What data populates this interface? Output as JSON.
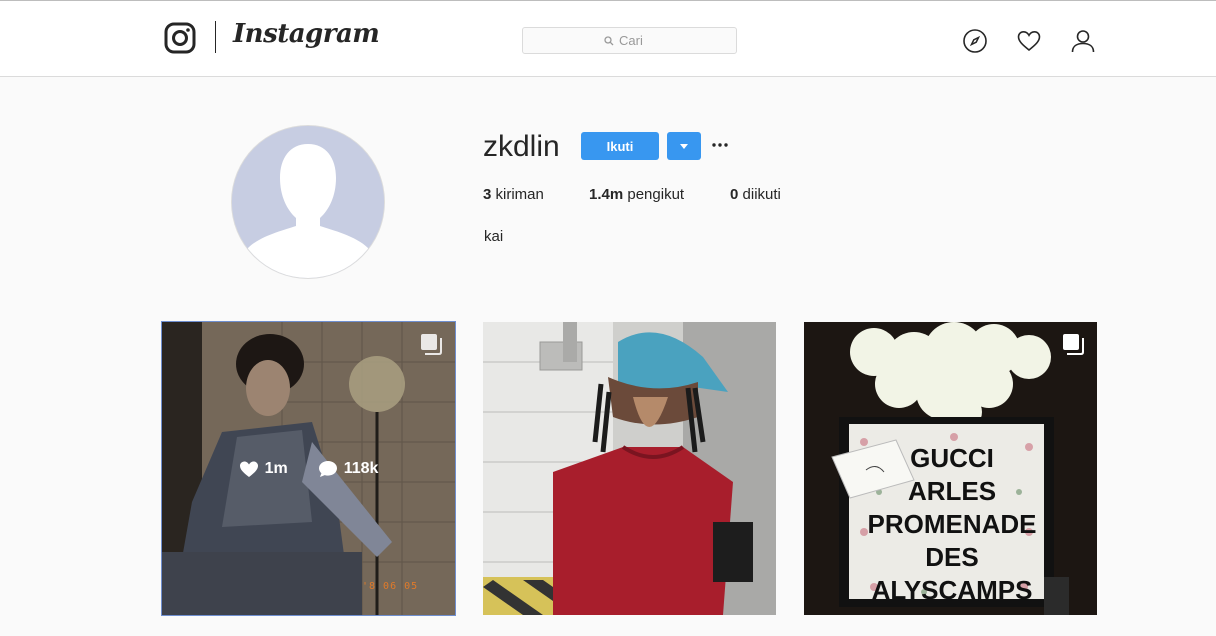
{
  "brand": {
    "wordmark": "Instagram"
  },
  "search": {
    "placeholder": "Cari",
    "icon": "search-icon"
  },
  "nav": {
    "icons": [
      "compass-icon",
      "heart-icon",
      "person-icon"
    ]
  },
  "profile": {
    "username": "zkdlin",
    "follow_label": "Ikuti",
    "stats": {
      "posts_count": "3",
      "posts_label": "kiriman",
      "followers_count": "1.4m",
      "followers_label": "pengikut",
      "following_count": "0",
      "following_label": "diikuti"
    },
    "bio": "kai"
  },
  "posts": [
    {
      "likes": "1m",
      "comments": "118k",
      "multi": true,
      "date_stamp": "'8 06 05"
    },
    {
      "multi": false
    },
    {
      "multi": true,
      "card_text": [
        "GUCCI",
        "ARLES",
        "PROMENADE",
        "DES",
        "ALYSCAMPS"
      ]
    }
  ],
  "colors": {
    "accent": "#3897f0",
    "background": "#fafafa",
    "text": "#262626"
  }
}
